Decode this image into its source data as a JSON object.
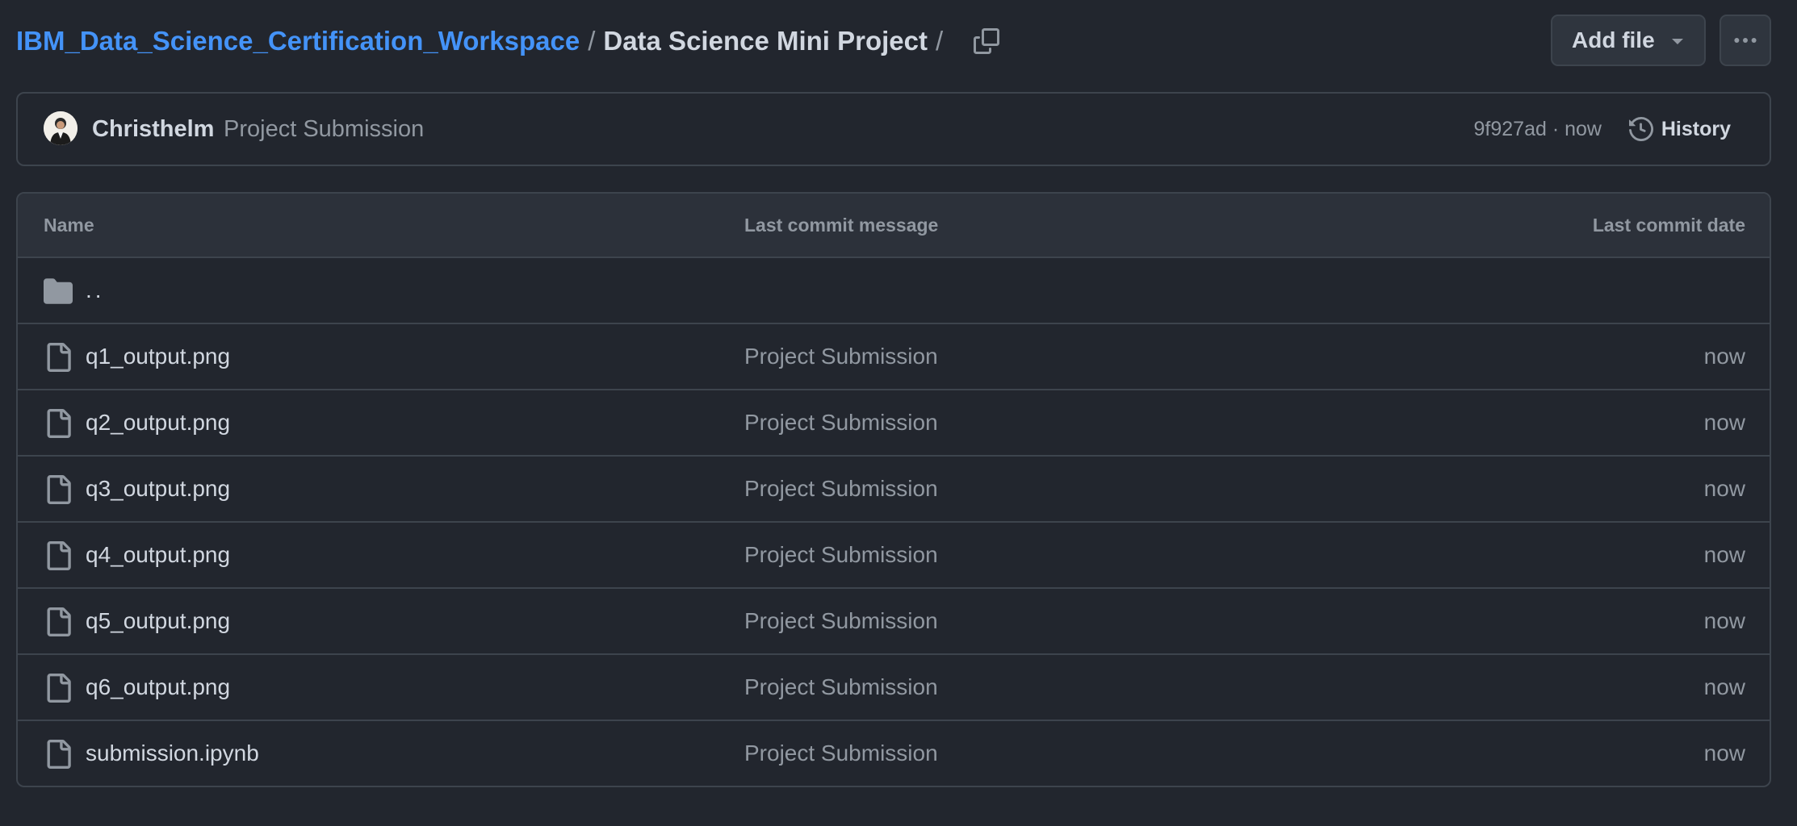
{
  "breadcrumb": {
    "repo": "IBM_Data_Science_Certification_Workspace",
    "separator": "/",
    "current": "Data Science Mini Project",
    "trailing": "/"
  },
  "toolbar": {
    "add_file_label": "Add file",
    "more_icon": "kebab-horizontal-icon",
    "copy_icon": "copy-icon"
  },
  "commit": {
    "author": "Christhelm",
    "message": "Project Submission",
    "sha": "9f927ad",
    "dot": "·",
    "time": "now",
    "history_label": "History"
  },
  "table": {
    "headers": {
      "name": "Name",
      "message": "Last commit message",
      "date": "Last commit date"
    },
    "parent": "..",
    "rows": [
      {
        "name": "q1_output.png",
        "message": "Project Submission",
        "date": "now"
      },
      {
        "name": "q2_output.png",
        "message": "Project Submission",
        "date": "now"
      },
      {
        "name": "q3_output.png",
        "message": "Project Submission",
        "date": "now"
      },
      {
        "name": "q4_output.png",
        "message": "Project Submission",
        "date": "now"
      },
      {
        "name": "q5_output.png",
        "message": "Project Submission",
        "date": "now"
      },
      {
        "name": "q6_output.png",
        "message": "Project Submission",
        "date": "now"
      },
      {
        "name": "submission.ipynb",
        "message": "Project Submission",
        "date": "now"
      }
    ]
  },
  "colors": {
    "background": "#22262e",
    "link": "#4493f8",
    "border": "#3d444d",
    "muted": "#9198a1"
  }
}
